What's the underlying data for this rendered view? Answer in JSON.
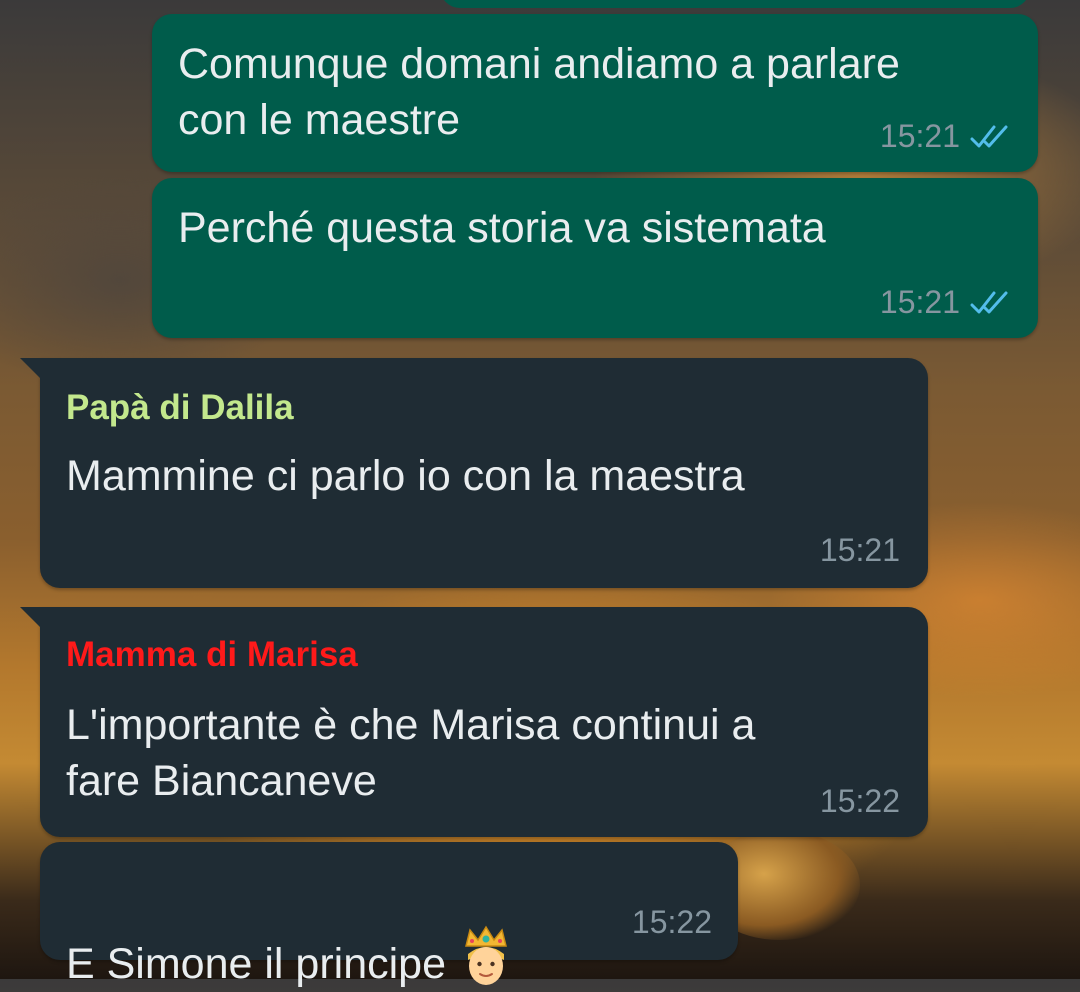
{
  "accent": {
    "outgoing_bubble": "#005c4b",
    "incoming_bubble": "#1f2c34",
    "read_ticks": "#53bdeb",
    "sender_green": "#c3e88d",
    "sender_red": "#ff1a1a"
  },
  "messages": [
    {
      "direction": "outgoing",
      "text": "Comunque domani andiamo a parlare\ncon le maestre",
      "time": "15:21",
      "status_icon": "double-check-read-icon"
    },
    {
      "direction": "outgoing",
      "text": "Perché questa storia va sistemata",
      "time": "15:21",
      "status_icon": "double-check-read-icon"
    },
    {
      "direction": "incoming",
      "sender": "Papà di Dalila",
      "text": "Mammine ci parlo io con la maestra",
      "time": "15:21"
    },
    {
      "direction": "incoming",
      "sender": "Mamma di Marisa",
      "text": "L'importante è che Marisa continui a\nfare Biancaneve",
      "time": "15:22"
    },
    {
      "direction": "incoming",
      "text": "E Simone il principe",
      "emoji": "prince-emoji",
      "time": "15:22"
    }
  ]
}
